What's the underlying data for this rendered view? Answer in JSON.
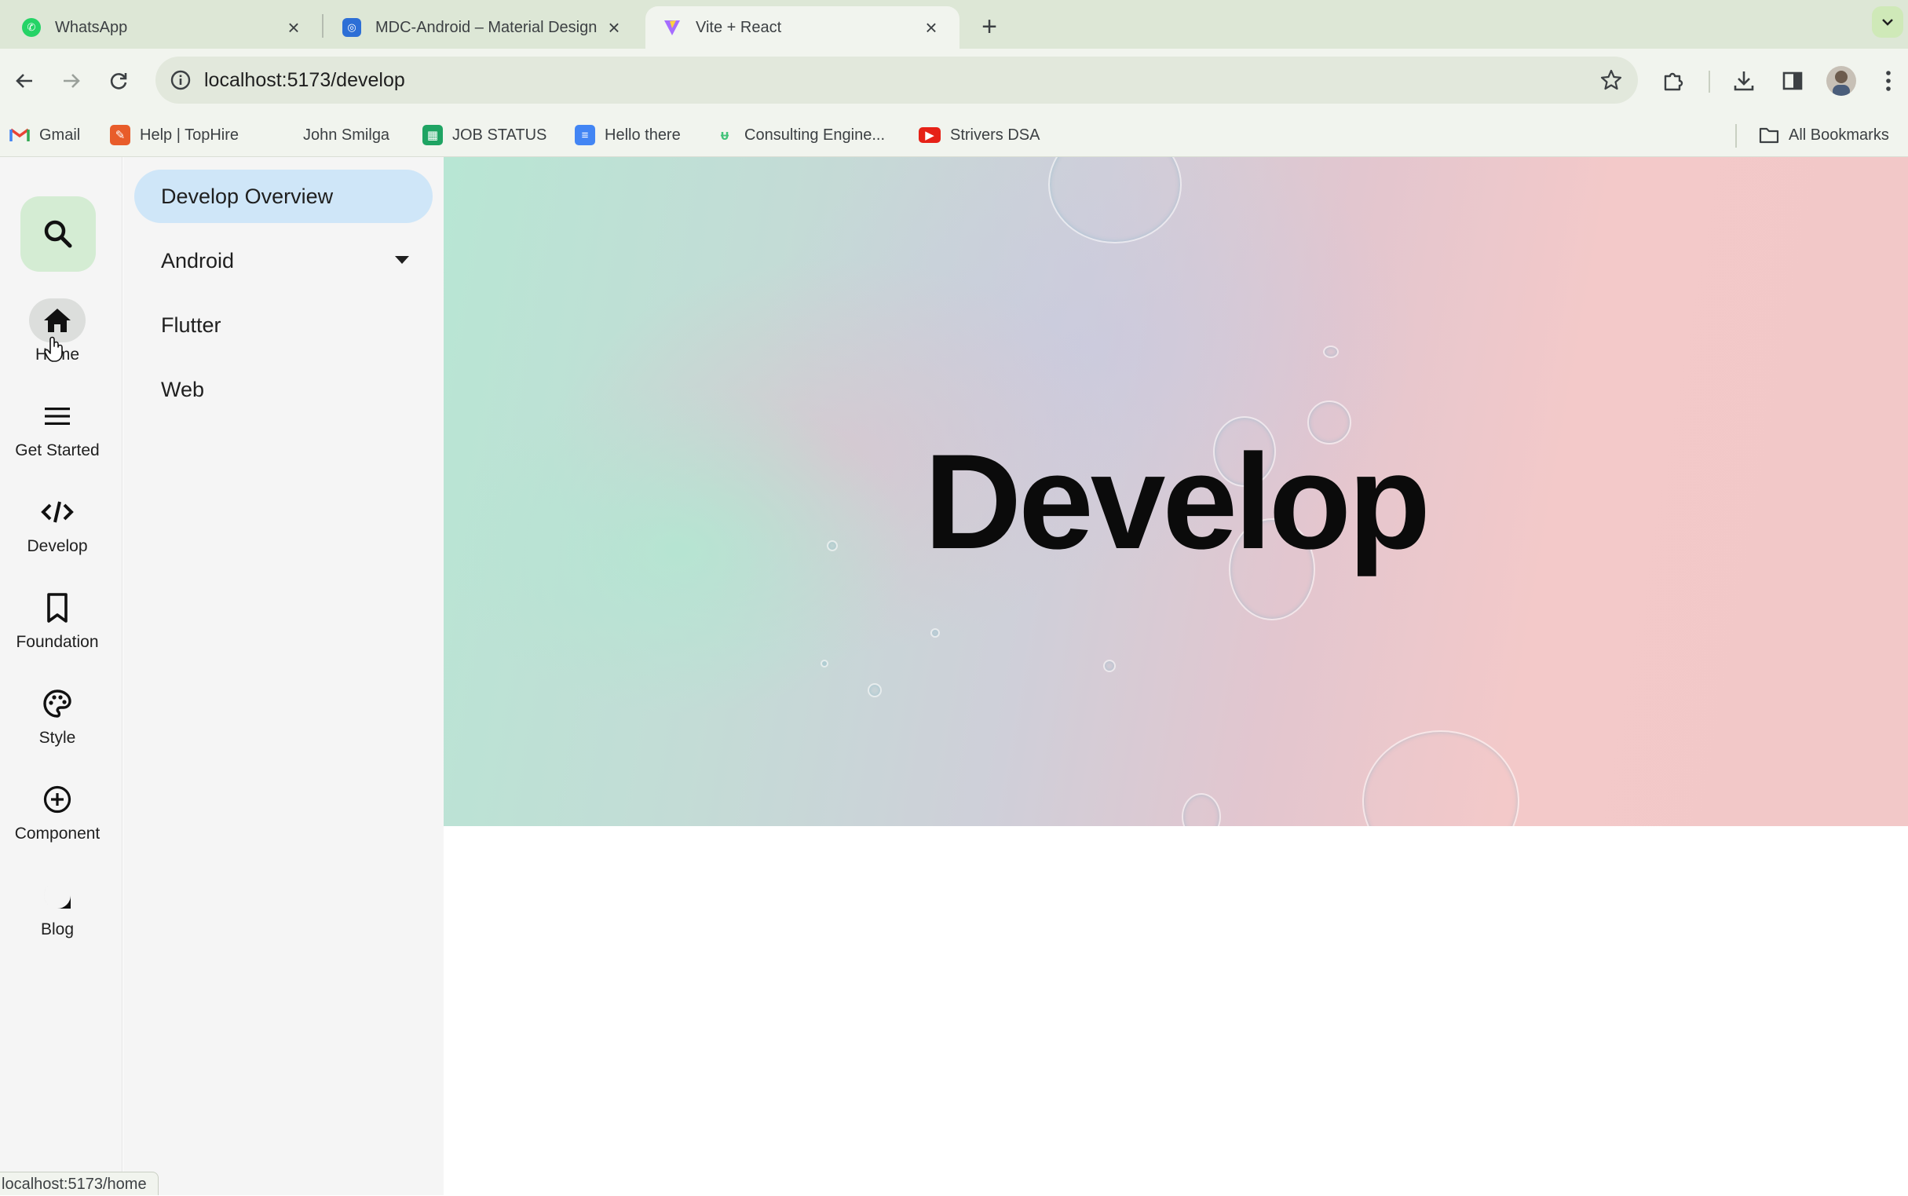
{
  "browser": {
    "tabs": [
      {
        "title": "WhatsApp",
        "icon": "whatsapp-icon",
        "active": false
      },
      {
        "title": "MDC-Android – Material Design",
        "icon": "material-design-icon",
        "active": false
      },
      {
        "title": "Vite + React",
        "icon": "vite-icon",
        "active": true
      }
    ],
    "new_tab_label": "+",
    "url": "localhost:5173/develop",
    "bookmarks": [
      {
        "label": "Gmail",
        "icon": "gmail-icon"
      },
      {
        "label": "Help | TopHire",
        "icon": "tophire-icon"
      },
      {
        "label": "John Smilga",
        "icon": "page-icon"
      },
      {
        "label": "JOB STATUS",
        "icon": "sheets-icon"
      },
      {
        "label": "Hello there",
        "icon": "docs-icon"
      },
      {
        "label": "Consulting Engine...",
        "icon": "consulting-icon"
      },
      {
        "label": "Strivers DSA",
        "icon": "youtube-icon"
      }
    ],
    "all_bookmarks_label": "All Bookmarks",
    "status_url": "localhost:5173/home"
  },
  "rail": {
    "items": [
      {
        "label": "Home",
        "icon": "home-icon"
      },
      {
        "label": "Get Started",
        "icon": "menu-icon"
      },
      {
        "label": "Develop",
        "icon": "code-icon"
      },
      {
        "label": "Foundation",
        "icon": "bookmark-icon"
      },
      {
        "label": "Style",
        "icon": "palette-icon"
      },
      {
        "label": "Component",
        "icon": "add-circle-icon"
      },
      {
        "label": "Blog",
        "icon": "star-chat-icon"
      }
    ]
  },
  "drawer": {
    "items": [
      {
        "label": "Develop Overview",
        "selected": true
      },
      {
        "label": "Android",
        "expandable": true
      },
      {
        "label": "Flutter"
      },
      {
        "label": "Web"
      }
    ]
  },
  "hero": {
    "title": "Develop"
  },
  "colors": {
    "drawer_selected": "#cfe6f8",
    "search_button": "#d4ecd3",
    "tabstrip": "#dde7d6"
  }
}
